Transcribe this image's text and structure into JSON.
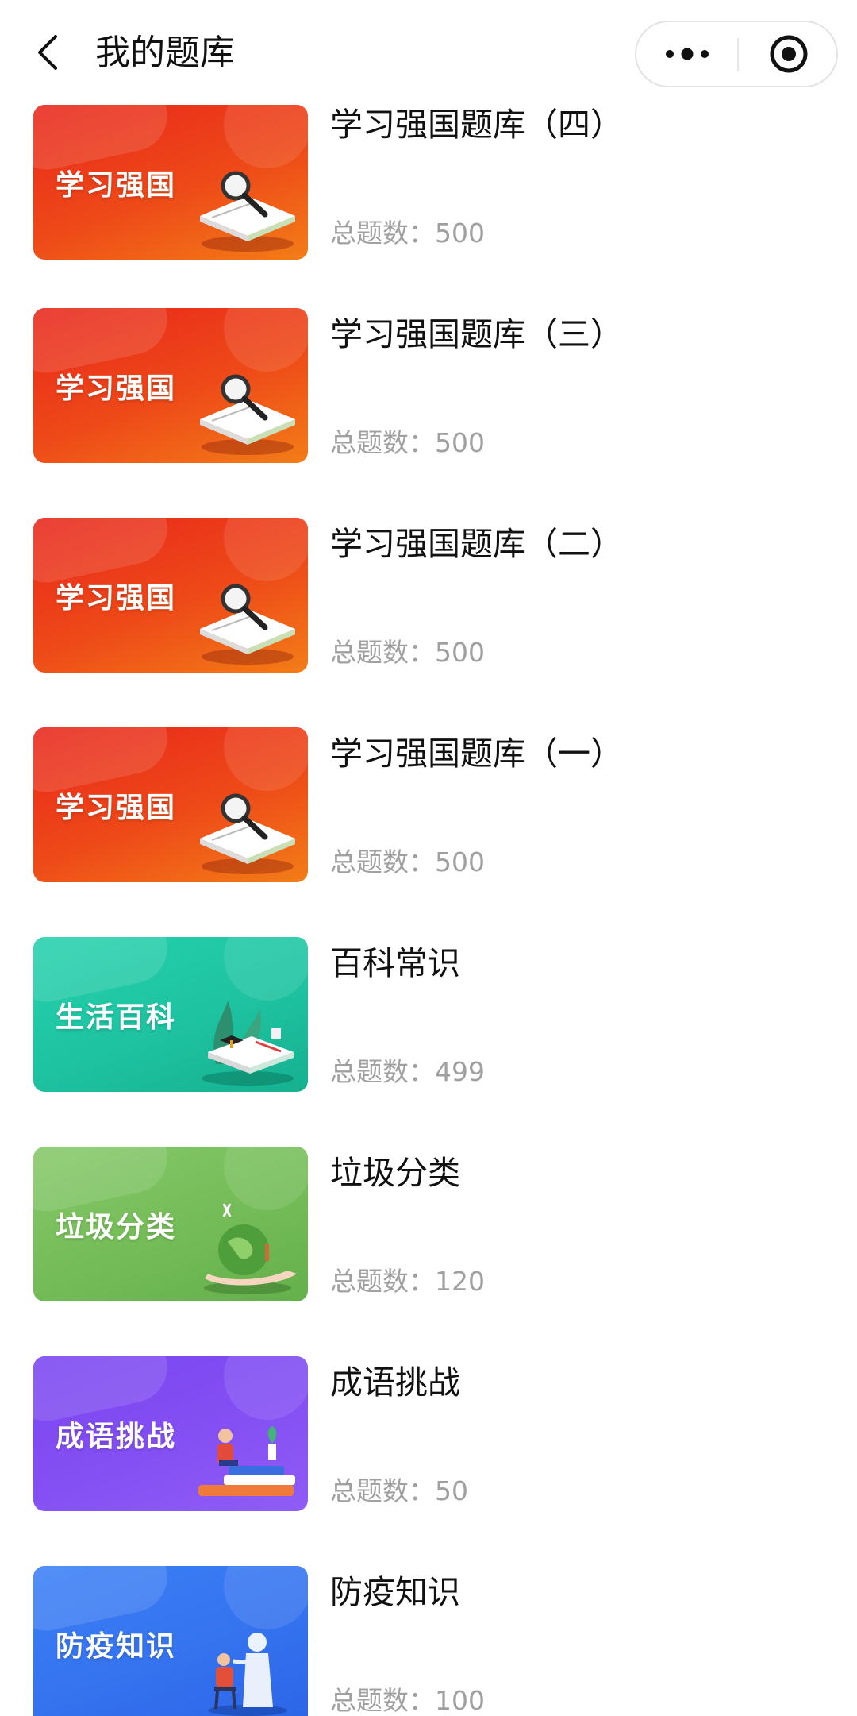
{
  "header": {
    "title": "我的题库",
    "back_icon": "chevron-left-icon",
    "more_icon": "more-dots-icon",
    "close_icon": "target-circle-icon"
  },
  "banks": [
    {
      "cover_text": "学习强国",
      "title": "学习强国题库（四）",
      "count": "总题数：500",
      "theme": "red",
      "illustration": "magnifier-book"
    },
    {
      "cover_text": "学习强国",
      "title": "学习强国题库（三）",
      "count": "总题数：500",
      "theme": "red",
      "illustration": "magnifier-book"
    },
    {
      "cover_text": "学习强国",
      "title": "学习强国题库（二）",
      "count": "总题数：500",
      "theme": "red",
      "illustration": "magnifier-book"
    },
    {
      "cover_text": "学习强国",
      "title": "学习强国题库（一）",
      "count": "总题数：500",
      "theme": "red",
      "illustration": "magnifier-book"
    },
    {
      "cover_text": "生活百科",
      "title": "百科常识",
      "count": "总题数：499",
      "theme": "teal",
      "illustration": "plant-book"
    },
    {
      "cover_text": "垃圾分类",
      "title": "垃圾分类",
      "count": "总题数：120",
      "theme": "green",
      "illustration": "globe-hand"
    },
    {
      "cover_text": "成语挑战",
      "title": "成语挑战",
      "count": "总题数：50",
      "theme": "purple",
      "illustration": "reader-books"
    },
    {
      "cover_text": "防疫知识",
      "title": "防疫知识",
      "count": "总题数：100",
      "theme": "blue",
      "illustration": "doctor-patient"
    }
  ],
  "colors": {
    "red": [
      "#e8261c",
      "#f07a16"
    ],
    "teal": [
      "#1fcba9",
      "#19b393"
    ],
    "green": [
      "#7dc35f",
      "#5fae4a"
    ],
    "purple": [
      "#7c4af2",
      "#8a57f5"
    ],
    "blue": [
      "#3a7cf5",
      "#2f6aeb"
    ]
  }
}
